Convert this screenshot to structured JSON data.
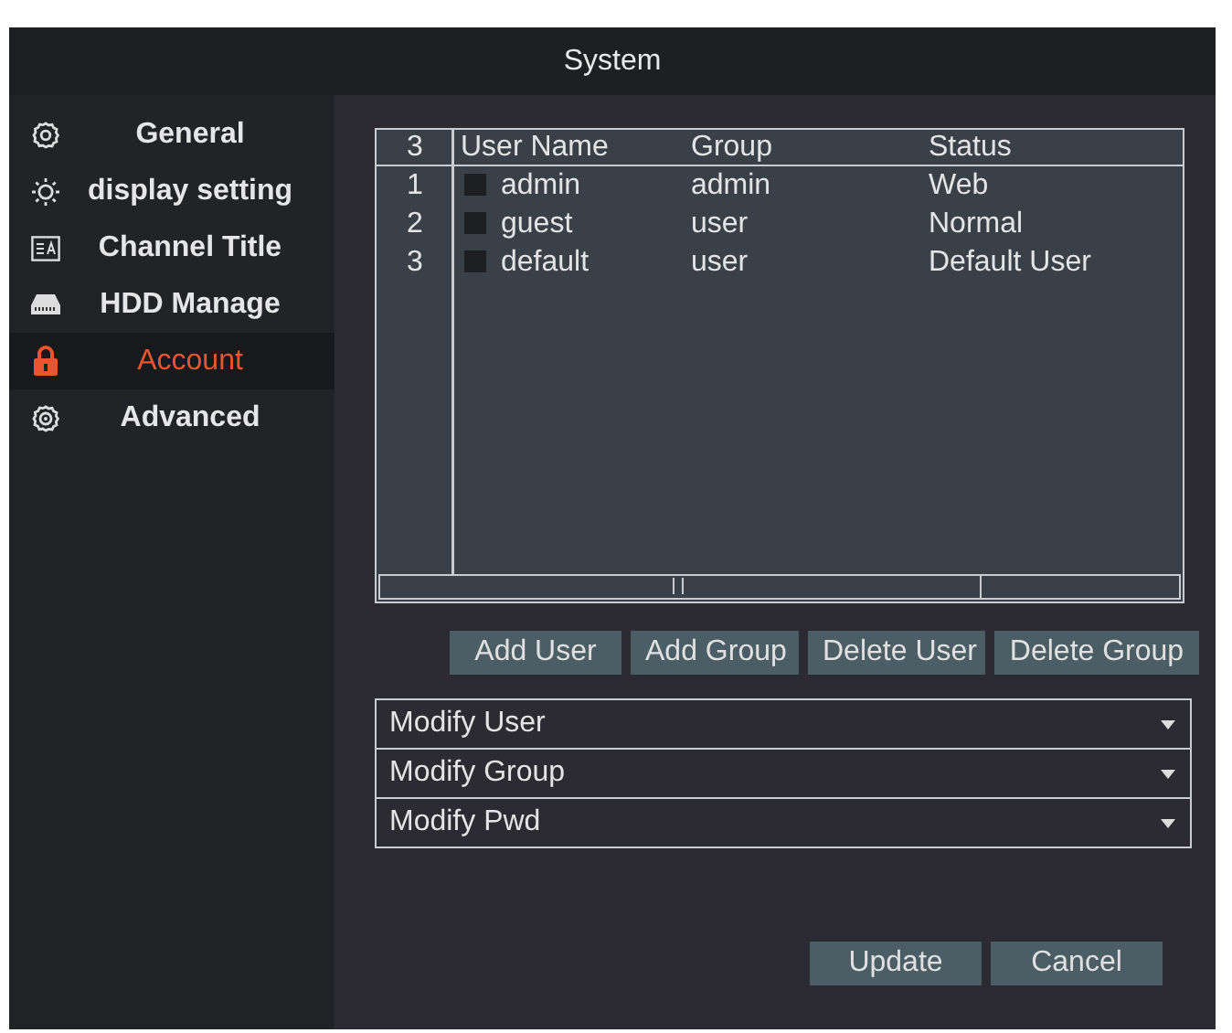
{
  "window": {
    "title": "System"
  },
  "sidebar": {
    "items": [
      {
        "label": "General",
        "kind": "gear",
        "selected": false
      },
      {
        "label": "display setting",
        "kind": "sun",
        "selected": false
      },
      {
        "label": "Channel Title",
        "kind": "title",
        "selected": false
      },
      {
        "label": "HDD Manage",
        "kind": "disk",
        "selected": false
      },
      {
        "label": "Account",
        "kind": "lock",
        "selected": true
      },
      {
        "label": "Advanced",
        "kind": "cog",
        "selected": false
      }
    ]
  },
  "table": {
    "count": "3",
    "columns": [
      "User Name",
      "Group",
      "Status"
    ],
    "rows": [
      {
        "index": "1",
        "checked": false,
        "cells": [
          "admin",
          "admin",
          "Web"
        ]
      },
      {
        "index": "2",
        "checked": false,
        "cells": [
          "guest",
          "user",
          "Normal"
        ]
      },
      {
        "index": "3",
        "checked": false,
        "cells": [
          "default",
          "user",
          "Default User"
        ]
      }
    ]
  },
  "actions": [
    "Add User",
    "Add Group",
    "Delete User",
    "Delete Group"
  ],
  "dropdowns": [
    "Modify User",
    "Modify Group",
    "Modify Pwd"
  ],
  "footer_buttons": [
    "Update",
    "Cancel"
  ]
}
